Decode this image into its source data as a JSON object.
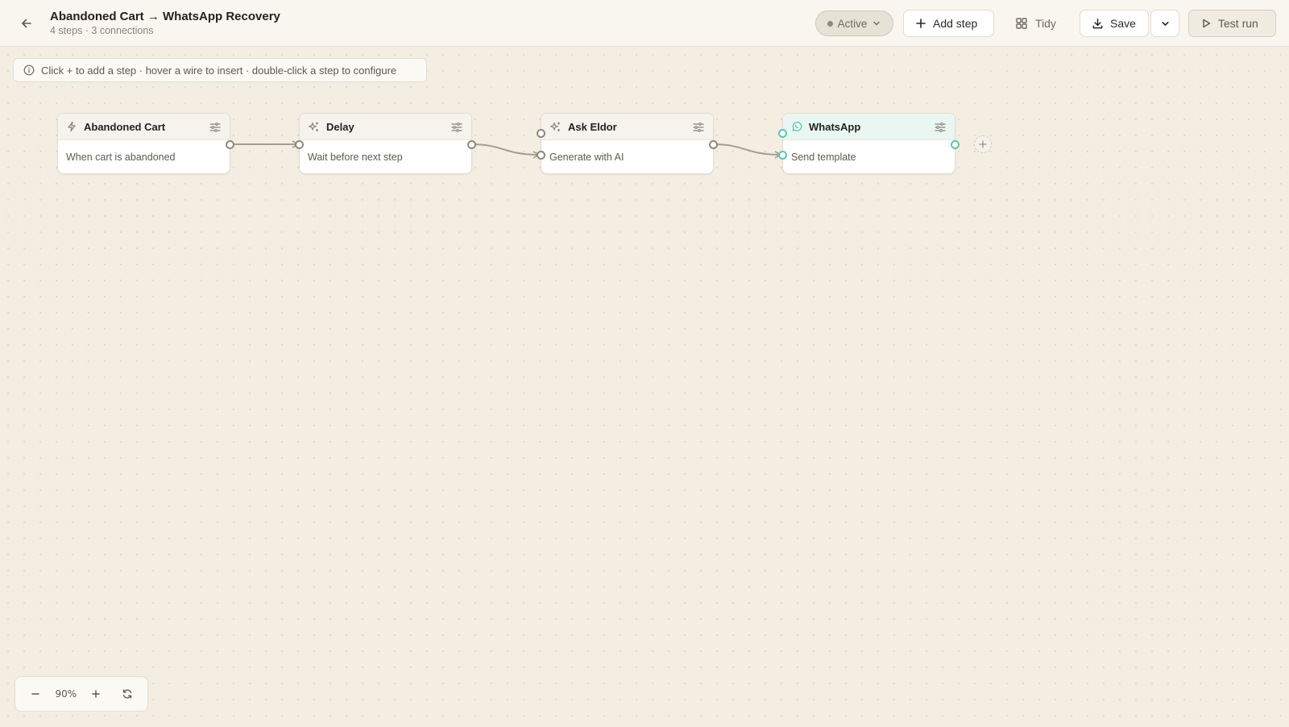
{
  "header": {
    "title": "Abandoned Cart → WhatsApp Recovery",
    "subtitle": "4 steps · 3 connections",
    "status_label": "Active",
    "add_step_label": "Add step",
    "tidy_label": "Tidy",
    "save_label": "Save",
    "test_run_label": "Test run"
  },
  "hint": {
    "text": "Click + to add a step · hover a wire to insert · double-click a step to configure"
  },
  "nodes": [
    {
      "title": "Abandoned Cart",
      "body": "When cart is abandoned",
      "icon": "bolt-icon"
    },
    {
      "title": "Delay",
      "body": "Wait before next step",
      "icon": "sparkle-icon"
    },
    {
      "title": "Ask Eldor",
      "body": "Generate with AI",
      "icon": "sparkle-icon"
    },
    {
      "title": "WhatsApp",
      "body": "Send template",
      "icon": "whatsapp-icon"
    }
  ],
  "zoom": {
    "level": "90%"
  },
  "colors": {
    "background": "#f3ede2",
    "accent_teal": "#5cc6b4",
    "wire": "#a39d92"
  }
}
